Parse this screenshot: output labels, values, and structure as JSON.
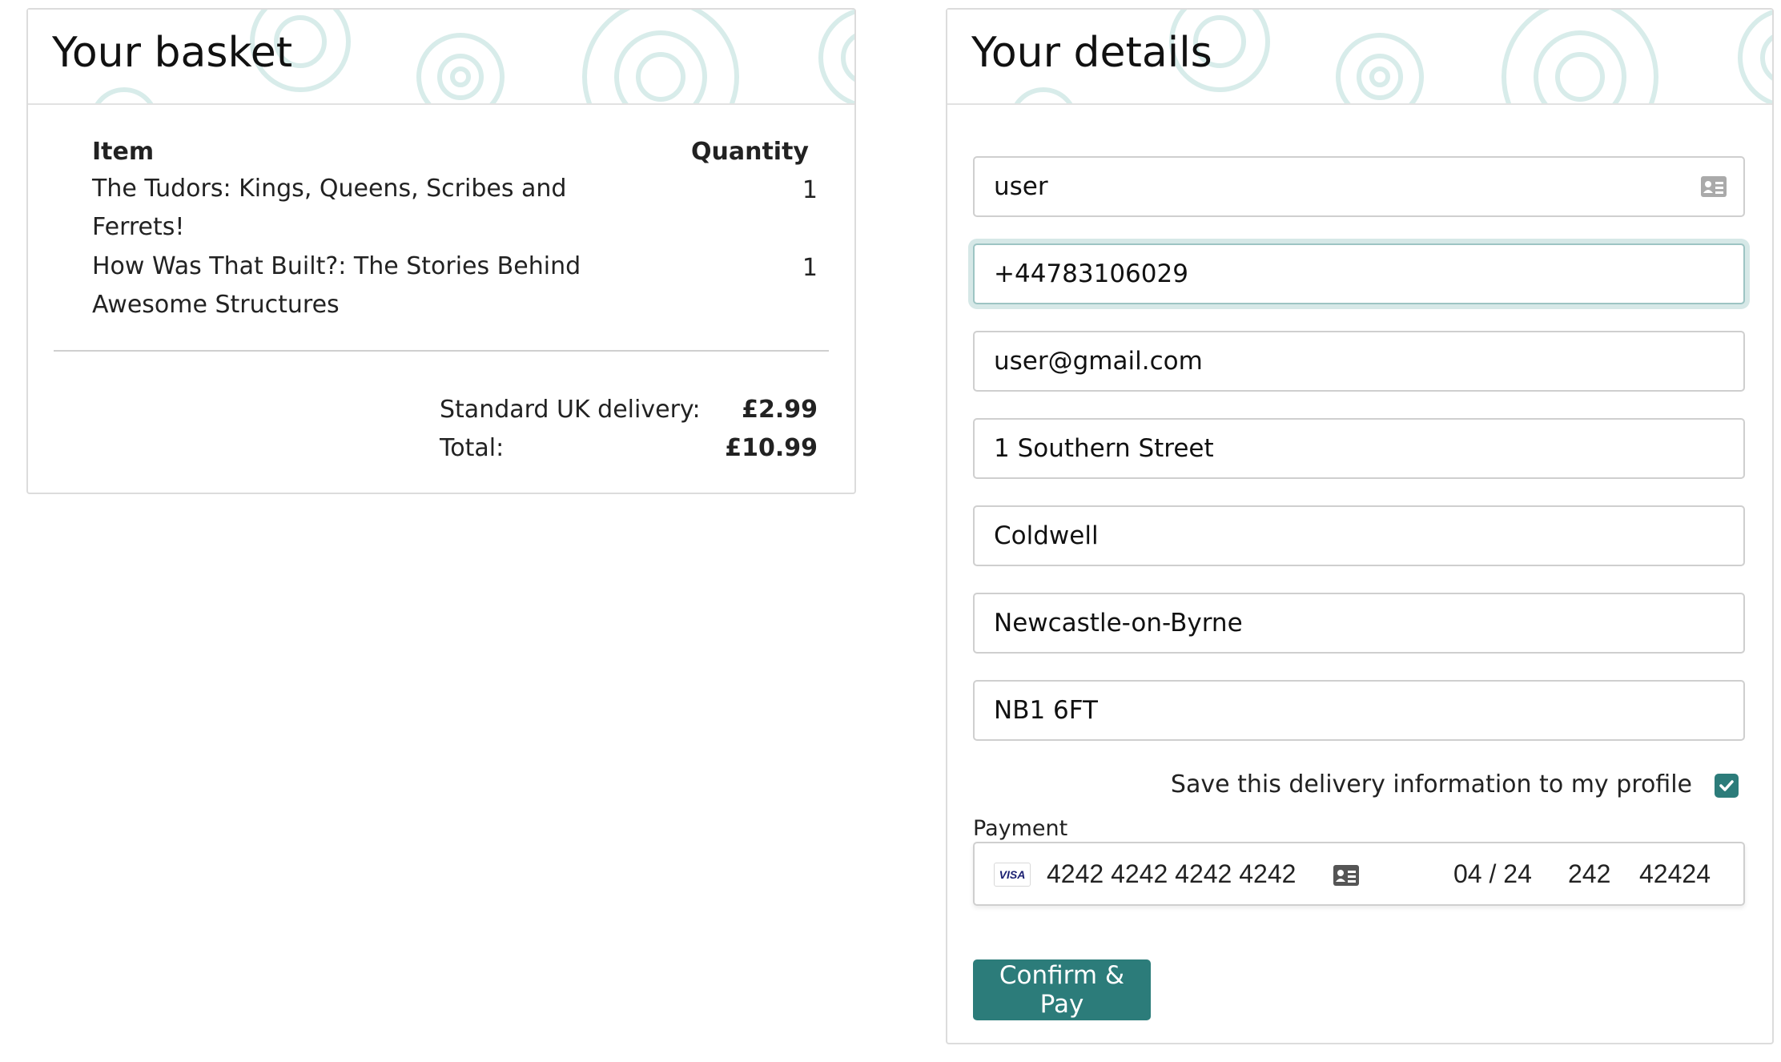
{
  "basket": {
    "title": "Your basket",
    "columns": {
      "item": "Item",
      "quantity": "Quantity"
    },
    "items": [
      {
        "name_line1": "The Tudors: Kings, Queens, Scribes and",
        "name_line2": "Ferrets!",
        "quantity": "1"
      },
      {
        "name_line1": "How Was That Built?: The Stories Behind",
        "name_line2": "Awesome Structures",
        "quantity": "1"
      }
    ],
    "delivery_label": "Standard UK delivery:",
    "delivery_value": "£2.99",
    "total_label": "Total:",
    "total_value": "£10.99"
  },
  "details": {
    "title": "Your details",
    "fields": {
      "name": "user",
      "phone": "+44783106029",
      "email": "user@gmail.com",
      "address": "1 Southern Street",
      "town": "Coldwell",
      "city": "Newcastle-on-Byrne",
      "postcode": "NB1 6FT"
    },
    "save_label": "Save this delivery information to my profile",
    "save_checked": true,
    "payment_label": "Payment",
    "payment": {
      "card_brand": "VISA",
      "card_number": "4242 4242 4242 4242",
      "expiry": "04 / 24",
      "cvc": "242",
      "postcode": "42424"
    },
    "confirm_label": "Confirm & Pay"
  },
  "colors": {
    "accent": "#2c7c7a",
    "header_pattern": "#d8ecea",
    "focus_ring": "#d6e8e7"
  }
}
